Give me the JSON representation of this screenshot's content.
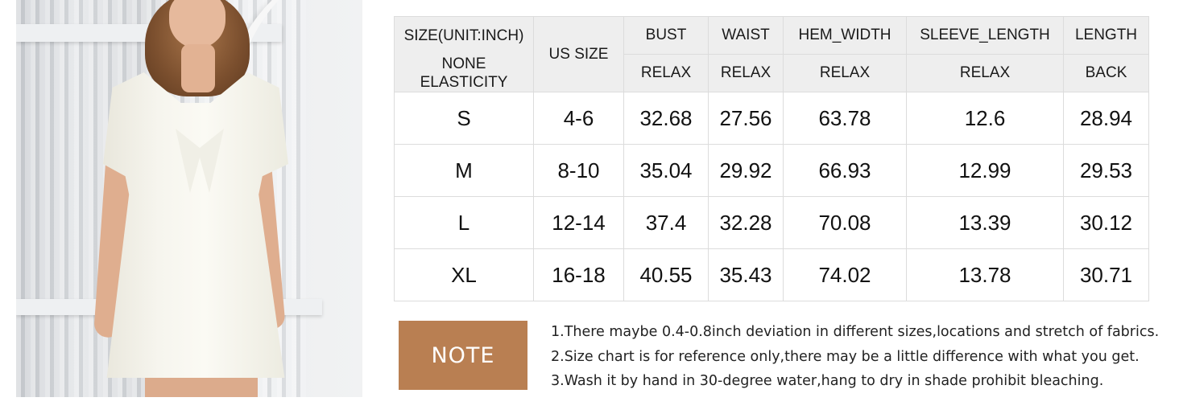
{
  "product_image": {
    "alt": "Woman wearing white short-sleeve tie-front dress"
  },
  "size_table": {
    "header_top": {
      "size_unit": "SIZE(UNIT:INCH)",
      "us_size": "US SIZE",
      "bust": "BUST",
      "waist": "WAIST",
      "hem_width": "HEM_WIDTH",
      "sleeve_length": "SLEEVE_LENGTH",
      "length": "LENGTH"
    },
    "header_sub": {
      "elasticity": "NONE ELASTICITY",
      "bust": "RELAX",
      "waist": "RELAX",
      "hem_width": "RELAX",
      "sleeve_length": "RELAX",
      "length": "BACK"
    },
    "rows": [
      {
        "size": "S",
        "us_size": "4-6",
        "bust": "32.68",
        "waist": "27.56",
        "hem_width": "63.78",
        "sleeve_length": "12.6",
        "length": "28.94"
      },
      {
        "size": "M",
        "us_size": "8-10",
        "bust": "35.04",
        "waist": "29.92",
        "hem_width": "66.93",
        "sleeve_length": "12.99",
        "length": "29.53"
      },
      {
        "size": "L",
        "us_size": "12-14",
        "bust": "37.4",
        "waist": "32.28",
        "hem_width": "70.08",
        "sleeve_length": "13.39",
        "length": "30.12"
      },
      {
        "size": "XL",
        "us_size": "16-18",
        "bust": "40.55",
        "waist": "35.43",
        "hem_width": "74.02",
        "sleeve_length": "13.78",
        "length": "30.71"
      }
    ]
  },
  "note": {
    "label": "NOTE",
    "color": "#b97f52",
    "lines": [
      "1.There maybe 0.4-0.8inch deviation in different sizes,locations and stretch of fabrics.",
      "2.Size chart is for reference only,there may be a little difference with what you get.",
      "3.Wash it by hand in 30-degree water,hang to dry in shade prohibit bleaching."
    ]
  }
}
